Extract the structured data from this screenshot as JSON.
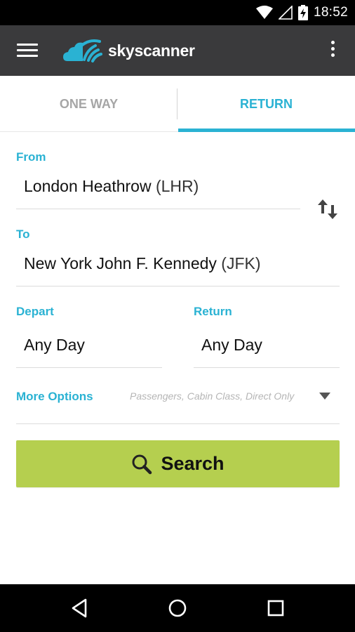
{
  "status_bar": {
    "time": "18:52",
    "icons": [
      "wifi-icon",
      "signal-icon",
      "battery-charging-icon"
    ]
  },
  "app_bar": {
    "menu_icon": "hamburger-menu-icon",
    "brand_name": "skyscanner",
    "overflow_icon": "more-vert-icon",
    "colors": {
      "background": "#3a3a3c",
      "logo": "#2ab2d3"
    }
  },
  "tabs": [
    {
      "label": "ONE WAY",
      "selected": false
    },
    {
      "label": "RETURN",
      "selected": true
    }
  ],
  "form": {
    "from": {
      "label": "From",
      "airport": "London Heathrow",
      "code": "(LHR)"
    },
    "to": {
      "label": "To",
      "airport": "New York John F. Kennedy",
      "code": "(JFK)"
    },
    "swap_icon": "swap-vertical-icon",
    "depart": {
      "label": "Depart",
      "value": "Any Day"
    },
    "return": {
      "label": "Return",
      "value": "Any Day"
    },
    "more_options": {
      "label": "More Options",
      "hint": "Passengers, Cabin Class, Direct Only",
      "icon": "dropdown-arrow-icon"
    }
  },
  "search_button": {
    "label": "Search",
    "icon": "search-icon",
    "color": "#b5cf4f"
  },
  "accent_color": "#2ab2d3",
  "nav_bar": {
    "buttons": [
      "back-icon",
      "home-icon",
      "recents-icon"
    ]
  }
}
